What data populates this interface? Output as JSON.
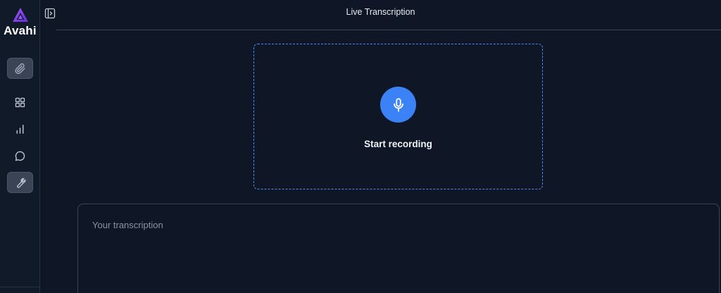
{
  "brand": {
    "name": "Avahi",
    "accent": "#7c3aed"
  },
  "sidebar": {
    "items": [
      {
        "icon": "paperclip-icon",
        "active": true
      },
      {
        "icon": "grid-icon",
        "active": false
      },
      {
        "icon": "bar-chart-icon",
        "active": false
      },
      {
        "icon": "chat-bubble-icon",
        "active": false
      },
      {
        "icon": "wrench-icon",
        "active": true
      }
    ]
  },
  "header": {
    "title": "Live Transcription",
    "toggle_icon": "sidebar-toggle-icon"
  },
  "recorder": {
    "label": "Start recording",
    "icon": "microphone-icon",
    "button_color": "#3b82f6",
    "border_color": "#4d8bf0"
  },
  "transcription": {
    "placeholder": "Your transcription",
    "value": ""
  }
}
